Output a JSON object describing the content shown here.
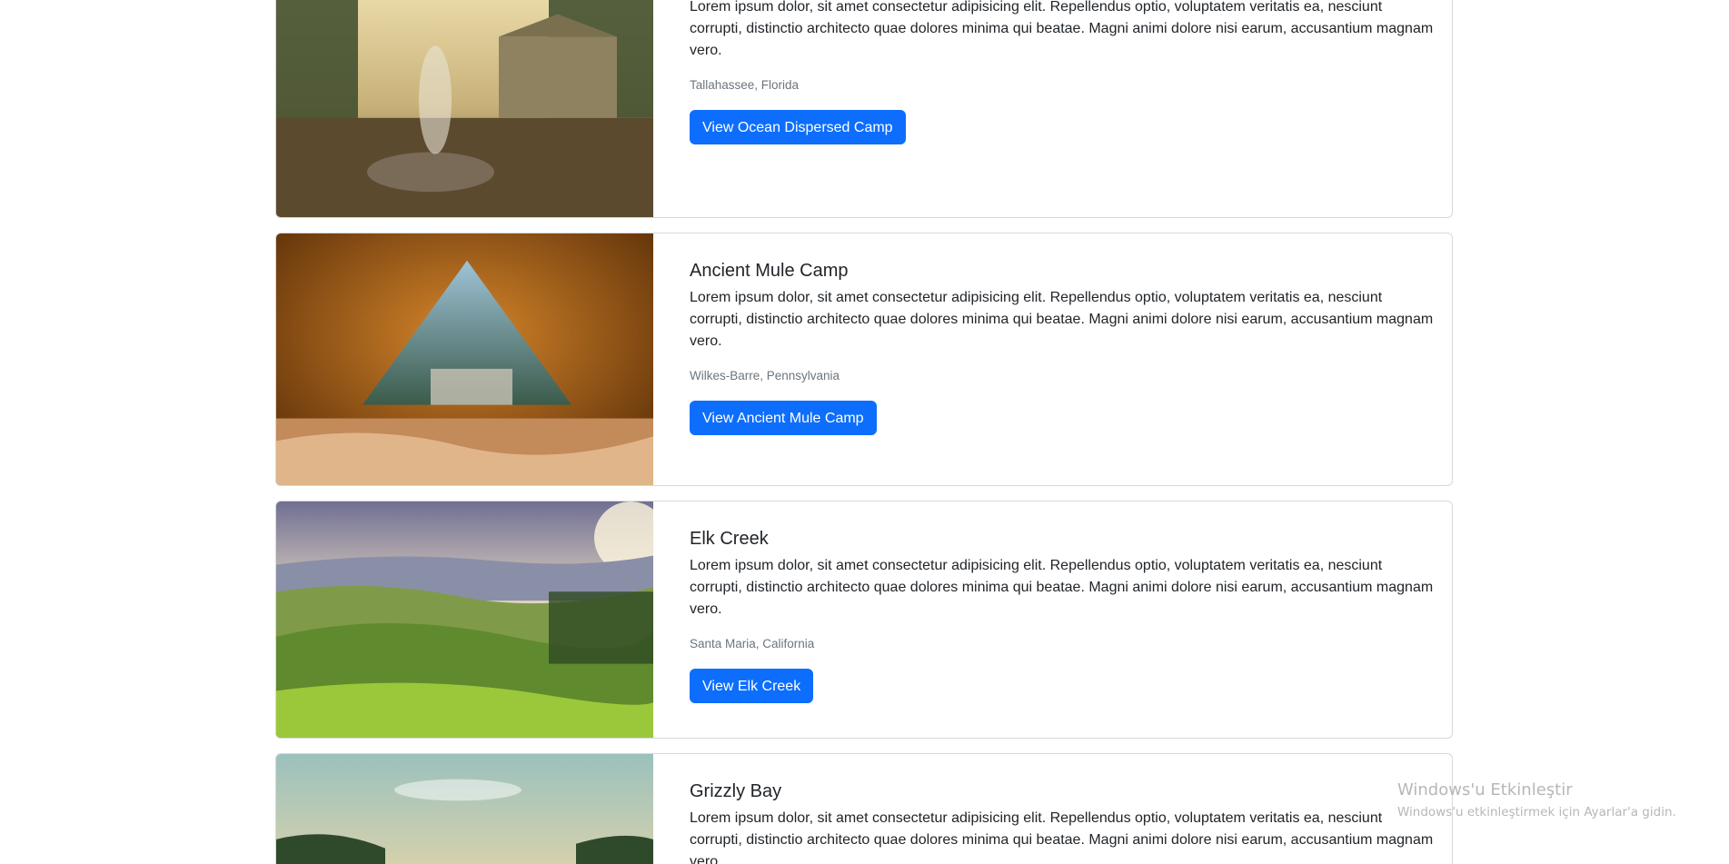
{
  "camps": [
    {
      "title": "",
      "description": "Lorem ipsum dolor, sit amet consectetur adipisicing elit. Repellendus optio, voluptatem veritatis ea, nesciunt corrupti, distinctio architecto quae dolores minima qui beatae. Magni animi dolore nisi earum, accusantium magnam vero.",
      "location": "Tallahassee, Florida",
      "button_label": "View Ocean Dispersed Camp"
    },
    {
      "title": "Ancient Mule Camp",
      "description": "Lorem ipsum dolor, sit amet consectetur adipisicing elit. Repellendus optio, voluptatem veritatis ea, nesciunt corrupti, distinctio architecto quae dolores minima qui beatae. Magni animi dolore nisi earum, accusantium magnam vero.",
      "location": "Wilkes-Barre, Pennsylvania",
      "button_label": "View Ancient Mule Camp"
    },
    {
      "title": "Elk Creek",
      "description": "Lorem ipsum dolor, sit amet consectetur adipisicing elit. Repellendus optio, voluptatem veritatis ea, nesciunt corrupti, distinctio architecto quae dolores minima qui beatae. Magni animi dolore nisi earum, accusantium magnam vero.",
      "location": "Santa Maria, California",
      "button_label": "View Elk Creek"
    },
    {
      "title": "Grizzly Bay",
      "description": "Lorem ipsum dolor, sit amet consectetur adipisicing elit. Repellendus optio, voluptatem veritatis ea, nesciunt corrupti, distinctio architecto quae dolores minima qui beatae. Magni animi dolore nisi earum, accusantium magnam vero."
    }
  ],
  "watermark": {
    "title": "Windows'u Etkinleştir",
    "subtitle": "Windows'u etkinleştirmek için Ayarlar'a gidin."
  },
  "colors": {
    "button": "#0d6efd",
    "muted_text": "#6c757d",
    "border": "#d6d8db"
  }
}
